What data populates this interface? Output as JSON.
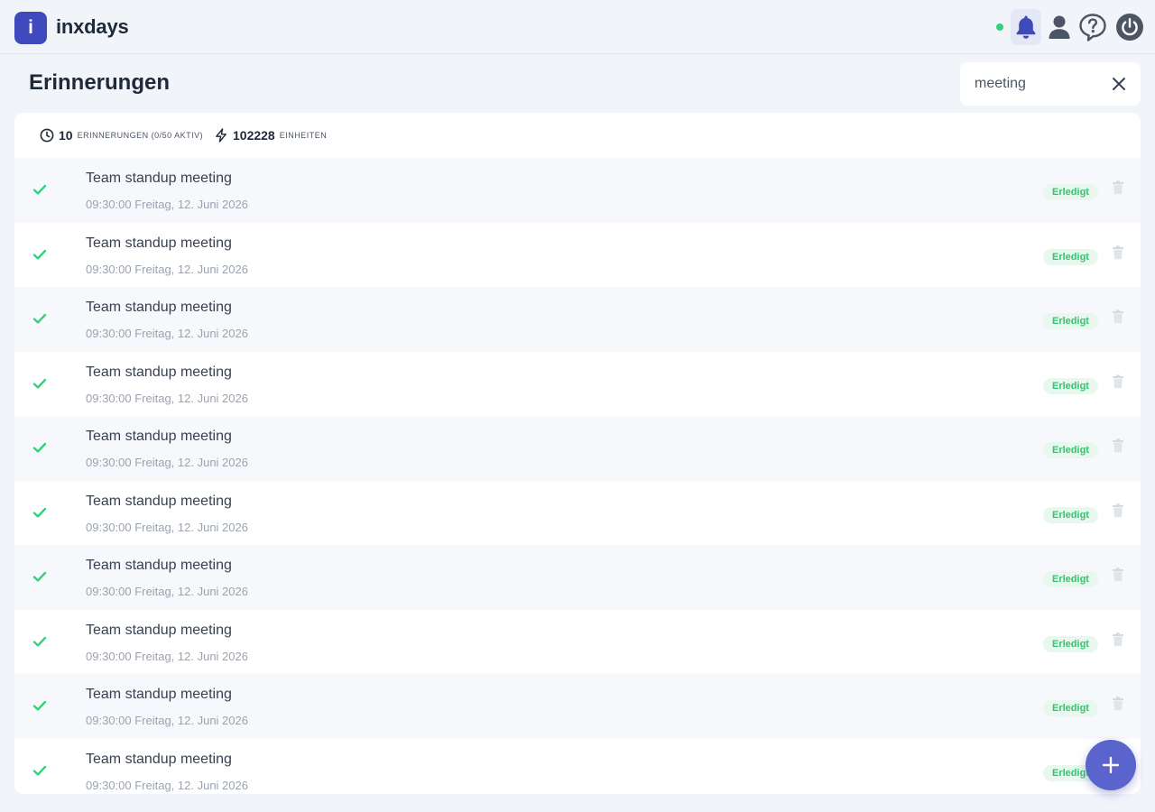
{
  "app": {
    "logo_letter": "i",
    "name": "inxdays"
  },
  "header_icons": [
    "bell-icon",
    "user-icon",
    "help-icon",
    "power-icon"
  ],
  "colors": {
    "accent": "#3f4bbd",
    "status_online": "#34d17b",
    "done_green": "#34c46f",
    "fab": "#5b63cc"
  },
  "page": {
    "title": "Erinnerungen"
  },
  "search": {
    "value": "meeting"
  },
  "stats": {
    "reminders_count": "10",
    "reminders_label": "Erinnerungen (0/50 aktiv)",
    "units_count": "102228",
    "units_label": "Einheiten"
  },
  "reminders": [
    {
      "title": "Team standup meeting",
      "time": "09:30:00 Freitag, 12. Juni 2026",
      "status": "Erledigt"
    },
    {
      "title": "Team standup meeting",
      "time": "09:30:00 Freitag, 12. Juni 2026",
      "status": "Erledigt"
    },
    {
      "title": "Team standup meeting",
      "time": "09:30:00 Freitag, 12. Juni 2026",
      "status": "Erledigt"
    },
    {
      "title": "Team standup meeting",
      "time": "09:30:00 Freitag, 12. Juni 2026",
      "status": "Erledigt"
    },
    {
      "title": "Team standup meeting",
      "time": "09:30:00 Freitag, 12. Juni 2026",
      "status": "Erledigt"
    },
    {
      "title": "Team standup meeting",
      "time": "09:30:00 Freitag, 12. Juni 2026",
      "status": "Erledigt"
    },
    {
      "title": "Team standup meeting",
      "time": "09:30:00 Freitag, 12. Juni 2026",
      "status": "Erledigt"
    },
    {
      "title": "Team standup meeting",
      "time": "09:30:00 Freitag, 12. Juni 2026",
      "status": "Erledigt"
    },
    {
      "title": "Team standup meeting",
      "time": "09:30:00 Freitag, 12. Juni 2026",
      "status": "Erledigt"
    },
    {
      "title": "Team standup meeting",
      "time": "09:30:00 Freitag, 12. Juni 2026",
      "status": "Erledigt"
    }
  ]
}
